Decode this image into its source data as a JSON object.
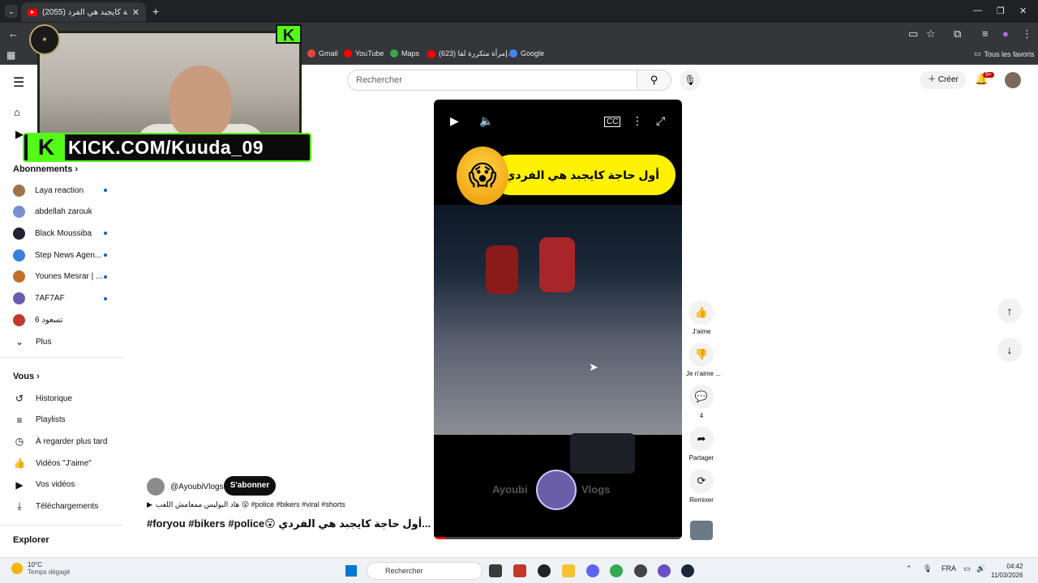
{
  "browser": {
    "tab_title": "(2055) أول حاجة كايجبد هي الفرد...",
    "bookmarks": [
      "Gmail",
      "YouTube",
      "Maps",
      "(623) إمرأة متكررة لقا...",
      "Google"
    ],
    "all_favorites": "Tous les favoris"
  },
  "overlay": {
    "kick_text": "KICK.COM/Kuuda_09",
    "kick_badge": "K",
    "corner_badge": "K"
  },
  "youtube": {
    "search_placeholder": "Rechercher",
    "create_label": "Créer",
    "notif_count": "9+"
  },
  "sidebar": {
    "subscriptions_title": "Abonnements",
    "subscriptions": [
      {
        "name": "Laya reaction",
        "live": true,
        "color": "#a0704a"
      },
      {
        "name": "abdellah zarouk",
        "live": false,
        "color": "#7a8fd0"
      },
      {
        "name": "Black Moussiba",
        "live": true,
        "color": "#222233"
      },
      {
        "name": "Step News Agen...",
        "live": true,
        "color": "#3a7fd8"
      },
      {
        "name": "Younes Mesrar | ...",
        "live": true,
        "color": "#c0702a"
      },
      {
        "name": "7AF7AF",
        "live": true,
        "color": "#6a5ab0"
      },
      {
        "name": "6 تسعود",
        "live": false,
        "color": "#c0392b"
      }
    ],
    "more_label": "Plus",
    "you_title": "Vous",
    "you_items": [
      {
        "label": "Historique",
        "icon": "history-icon"
      },
      {
        "label": "Playlists",
        "icon": "playlist-icon"
      },
      {
        "label": "À regarder plus tard",
        "icon": "clock-icon"
      },
      {
        "label": "Vidéos \"J'aime\"",
        "icon": "thumb-up-icon"
      },
      {
        "label": "Vos vidéos",
        "icon": "video-icon"
      },
      {
        "label": "Téléchargements",
        "icon": "download-icon"
      }
    ],
    "explore_title": "Explorer"
  },
  "video": {
    "overlay_title": "أول حاجة كايجبد هي الفردي",
    "channel_left": "Ayoubi",
    "channel_right": "Vlogs",
    "progress_fraction": 0.05
  },
  "actions": {
    "like": "J'aime",
    "dislike": "Je n'aime ...",
    "comments": "4",
    "share": "Partager",
    "remix": "Remixer"
  },
  "meta": {
    "channel": "@AyoubiVlogs",
    "subscribe": "S'abonner",
    "sound": "هاد البوليس ممعامش اللعب 😮 #police #bikers #viral #shorts",
    "title": "#foryou #bikers #police😮 أول حاجة كايجبد  هي  الفردي..."
  },
  "taskbar": {
    "temp": "10°C",
    "weather": "Temps dégagé",
    "search": "Rechercher",
    "lang": "FRA",
    "time": "04:42",
    "date": "11/03/2026"
  }
}
